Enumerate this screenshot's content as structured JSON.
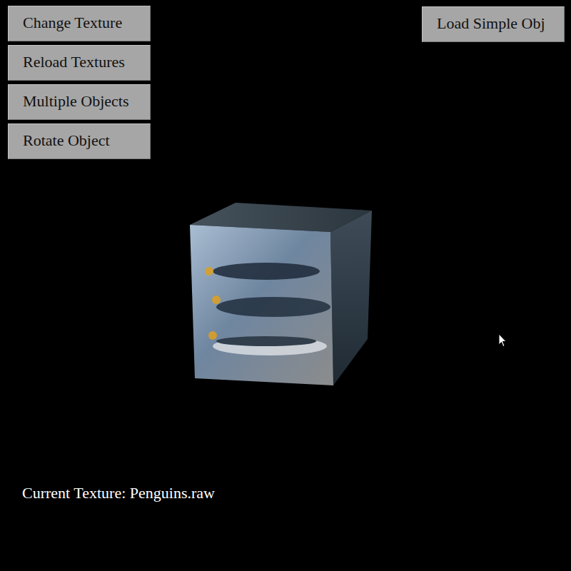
{
  "toolbar": {
    "buttons": [
      "Change Texture",
      "Reload Textures",
      "Multiple Objects",
      "Rotate Object"
    ]
  },
  "load_button": {
    "label": "Load Simple Obj"
  },
  "status": {
    "text": "Current Texture: Penguins.raw"
  }
}
